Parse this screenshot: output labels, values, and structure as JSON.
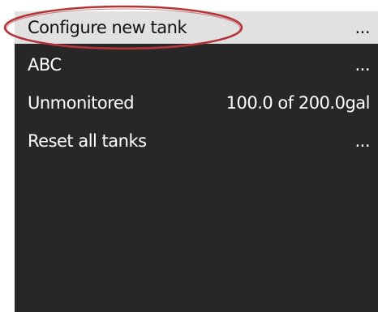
{
  "menu": {
    "items": [
      {
        "label": "Configure new tank",
        "value": "...",
        "selected": true
      },
      {
        "label": "ABC",
        "value": "..."
      },
      {
        "label": "Unmonitored",
        "value": "100.0 of 200.0gal"
      },
      {
        "label": "Reset all tanks",
        "value": "..."
      }
    ]
  },
  "colors": {
    "screen_background": "#272727",
    "selected_row": "#e1e1e1",
    "text_light": "#ffffff",
    "text_dark": "#111111",
    "annotation_ring": "#b5343a"
  }
}
